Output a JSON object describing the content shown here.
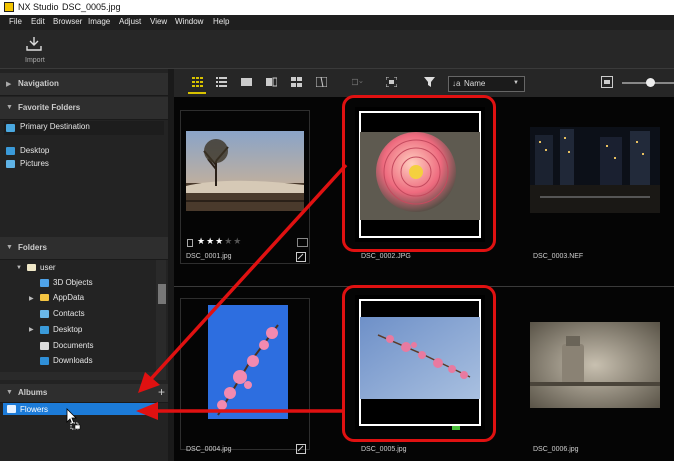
{
  "window": {
    "app_name": "NX Studio",
    "file_name": "DSC_0005.jpg"
  },
  "menu": [
    "File",
    "Edit",
    "Browser",
    "Image",
    "Adjust",
    "View",
    "Window",
    "Help"
  ],
  "toolbar": {
    "import_label": "Import"
  },
  "sidebar": {
    "navigation": "Navigation",
    "favorite_folders": "Favorite Folders",
    "primary_destination": "Primary Destination",
    "desktop": "Desktop",
    "pictures": "Pictures",
    "folders": "Folders",
    "tree": [
      "user",
      "3D Objects",
      "AppData",
      "Contacts",
      "Desktop",
      "Documents",
      "Downloads"
    ],
    "albums": "Albums",
    "album_add": "+",
    "album_item": "Flowers"
  },
  "viewbar": {
    "sort_label": "Name"
  },
  "thumbnails": [
    {
      "name": "DSC_0001.jpg",
      "rating": 3,
      "max_rating": 5
    },
    {
      "name": "DSC_0002.JPG"
    },
    {
      "name": "DSC_0003.NEF"
    },
    {
      "name": "DSC_0004.jpg"
    },
    {
      "name": "DSC_0005.jpg"
    },
    {
      "name": "DSC_0006.jpg"
    }
  ],
  "colors": {
    "highlight_blue": "#1c7bd8",
    "annotation_red": "#e01111",
    "accent_yellow": "#d8c200"
  }
}
